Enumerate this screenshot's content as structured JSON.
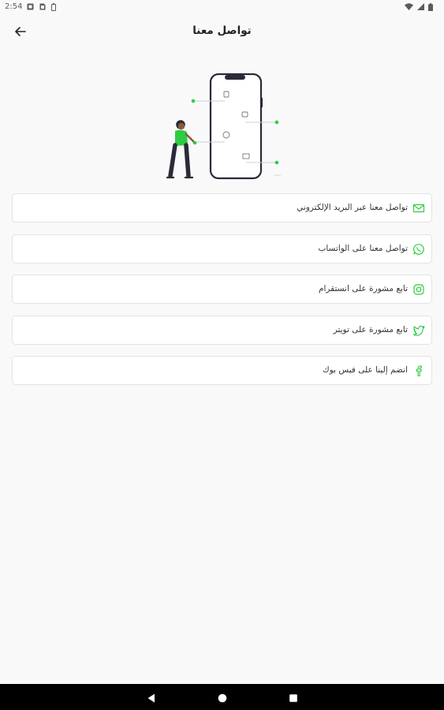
{
  "status_bar": {
    "time": "2:54",
    "left_icons": [
      "notification-icon",
      "sim-card-icon",
      "battery-saver-icon"
    ],
    "right_icons": [
      "wifi-icon",
      "signal-icon",
      "battery-icon"
    ]
  },
  "app_bar": {
    "title": "تواصل معنا",
    "back_icon": "arrow-left-icon"
  },
  "illustration": {
    "name": "person-with-phone-contact-illustration",
    "accent_color": "#2ecc40"
  },
  "options": [
    {
      "label": "تواصل معنا عبر البريد الإلكتروني",
      "icon": "email-icon"
    },
    {
      "label": "تواصل معنا على الواتساب",
      "icon": "whatsapp-icon"
    },
    {
      "label": "تابع مشورة على انستقرام",
      "icon": "instagram-icon"
    },
    {
      "label": "تابع مشورة على تويتر",
      "icon": "twitter-icon"
    },
    {
      "label": "انضم إلينا على فيس بوك",
      "icon": "facebook-icon"
    }
  ],
  "nav_bar": {
    "buttons": [
      "back-triangle-icon",
      "home-circle-icon",
      "recents-square-icon"
    ]
  },
  "colors": {
    "accent": "#2ecc40",
    "background": "#f9f9f9",
    "card_border": "#e3e3e3",
    "nav_bar": "#000000"
  }
}
